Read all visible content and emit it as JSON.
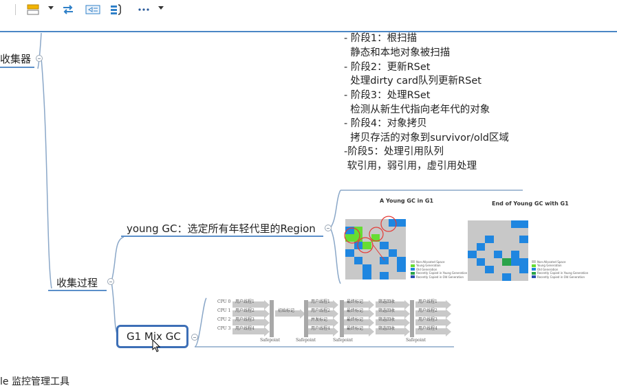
{
  "toolbar": {
    "icons": [
      "format-icon",
      "connector-icon",
      "relation-icon",
      "summary-icon",
      "more-icon"
    ]
  },
  "mindmap": {
    "root_partial": "收集器",
    "node_process": "收集过程",
    "node_young": "young GC：选定所有年轻代里的Region",
    "node_mix": "G1 Mix GC",
    "bottom_partial": "le 监控管理工具",
    "notes": [
      "- 阶段1：根扫描",
      "  静态和本地对象被扫描",
      "- 阶段2：更新RSet",
      "  处理dirty card队列更新RSet",
      "- 阶段3：处理RSet",
      "  检测从新生代指向老年代的对象",
      "- 阶段4：对象拷贝",
      "  拷贝存活的对象到survivor/old区域",
      "-阶段5：处理引用队列",
      " 软引用，弱引用，虚引用处理"
    ]
  },
  "young_gc_figure": {
    "left_title": "A Young GC in G1",
    "right_title": "End of Young GC with G1",
    "legend": [
      "Non-Allocated Space",
      "Young Generation",
      "Old Generation",
      "Recently Copied in Young Generation",
      "Recently Copied in Old Generation"
    ],
    "colors": {
      "empty": "#c8c8c8",
      "young": "#66dd33",
      "old": "#1f86e0",
      "copied_young": "#2aa34a",
      "copied_old": "#2a4fb0"
    }
  },
  "mixed_gc_figure": {
    "cpus": [
      "CPU 0",
      "CPU 1",
      "CPU 2",
      "CPU 3"
    ],
    "user_thread_labels": [
      "用户线程1",
      "用户线程2",
      "用户线程3",
      "用户线程4"
    ],
    "phase_initial": "初始标记",
    "col2_labels": [
      "用户线程1",
      "用户线程2",
      "并发标记",
      "用户线程4"
    ],
    "col3_label": "最终标记",
    "col4_label": "筛选回收",
    "safepoint": "Safepoint"
  }
}
